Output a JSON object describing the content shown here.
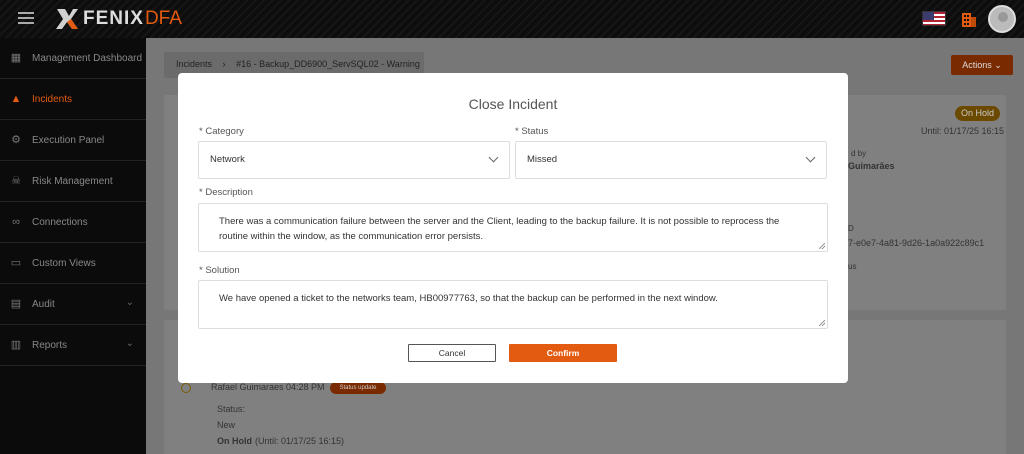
{
  "header": {
    "logo_main": "FENIX",
    "logo_sub": "DFA"
  },
  "sidebar": {
    "items": [
      {
        "label": "Management Dashboard",
        "icon": "dashboard-icon"
      },
      {
        "label": "Incidents",
        "icon": "flame-icon",
        "active": true
      },
      {
        "label": "Execution Panel",
        "icon": "gear-icon"
      },
      {
        "label": "Risk Management",
        "icon": "skull-icon"
      },
      {
        "label": "Connections",
        "icon": "link-icon"
      },
      {
        "label": "Custom Views",
        "icon": "monitor-icon"
      },
      {
        "label": "Audit",
        "icon": "clipboard-icon",
        "expandable": true
      },
      {
        "label": "Reports",
        "icon": "report-icon",
        "expandable": true
      }
    ]
  },
  "breadcrumb": {
    "root": "Incidents",
    "current": "#16 - Backup_DD6900_ServSQL02 - Warning"
  },
  "actions_label": "Actions",
  "background": {
    "status_badge": "On Hold",
    "until": "Until: 01/17/25 16:15",
    "by_label": "d by",
    "by_name": "Guimarães",
    "id_label": "D",
    "id_value": "7-e0e7-4a81-9d26-1a0a922c89c1",
    "status_frag": "us",
    "timeline_user": "Rafael Guimaraes",
    "timeline_time": "04:28 PM",
    "timeline_badge": "Status update",
    "timeline_status_label": "Status:",
    "timeline_old": "New",
    "timeline_new": "On Hold",
    "timeline_until": "(Until: 01/17/25 16:15)"
  },
  "modal": {
    "title": "Close Incident",
    "category_label": "* Category",
    "category_value": "Network",
    "status_label": "* Status",
    "status_value": "Missed",
    "description_label": "* Description",
    "description_value": "There was a communication failure between the server and the Client, leading to the backup failure. It is not possible to reprocess the routine within the window, as the communication error persists.",
    "solution_label": "* Solution",
    "solution_value": "We have opened a ticket to the networks team, HB00977763, so that the backup can be performed in the next window.",
    "cancel_label": "Cancel",
    "confirm_label": "Confirm"
  },
  "colors": {
    "accent": "#e35b10",
    "sidebar_bg": "#0b0b0b",
    "overlay": "#777777"
  }
}
